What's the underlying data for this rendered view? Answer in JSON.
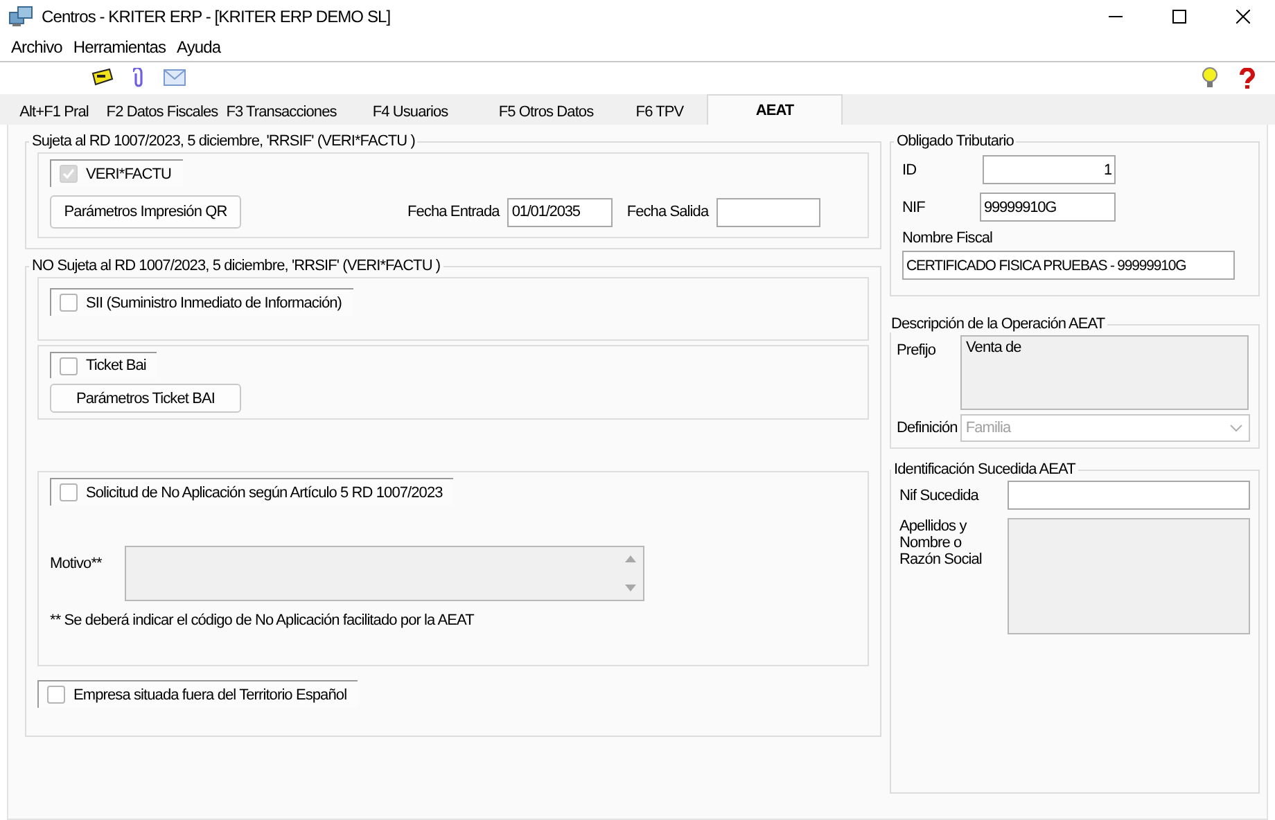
{
  "window": {
    "title": "Centros - KRITER ERP -  [KRITER ERP DEMO SL]"
  },
  "menu": [
    "Archivo",
    "Herramientas",
    "Ayuda"
  ],
  "tabs": [
    {
      "label": "Alt+F1 Pral",
      "selected": false
    },
    {
      "label": "F2 Datos Fiscales",
      "selected": false
    },
    {
      "label": "F3 Transacciones",
      "selected": false
    },
    {
      "label": "F4 Usuarios",
      "selected": false
    },
    {
      "label": "F5 Otros Datos",
      "selected": false
    },
    {
      "label": "F6 TPV",
      "selected": false
    },
    {
      "label": "AEAT",
      "selected": true
    }
  ],
  "sujeta": {
    "title": "Sujeta al RD 1007/2023, 5 diciembre, 'RRSIF'  (VERI*FACTU )",
    "verifactu": {
      "label": "VERI*FACTU",
      "checked": true,
      "disabled": true
    },
    "qr_button": "Parámetros Impresión QR",
    "fecha_entrada": {
      "label": "Fecha Entrada",
      "value": "01/01/2035"
    },
    "fecha_salida": {
      "label": "Fecha Salida"
    }
  },
  "no_sujeta": {
    "title": "NO Sujeta al RD 1007/2023, 5 diciembre, 'RRSIF'  (VERI*FACTU )",
    "sii": {
      "label": "SII (Suministro Inmediato de Información)",
      "checked": false,
      "disabled": false
    },
    "ticket_bai": {
      "label": "Ticket Bai",
      "checked": false,
      "disabled": false
    },
    "ticket_bai_button": "Parámetros Ticket BAI",
    "no_aplicacion": {
      "label": "Solicitud de No Aplicación según Artículo 5 RD 1007/2023",
      "checked": false,
      "disabled": false
    },
    "motivo": {
      "label": "Motivo**"
    },
    "note": "** Se deberá indicar el código de No Aplicación facilitado por la AEAT",
    "fuera_territorio": {
      "label": "Empresa situada fuera del Territorio Español",
      "checked": false,
      "disabled": false
    }
  },
  "obligado": {
    "title": "Obligado Tributario",
    "id": {
      "label": "ID",
      "value": "1"
    },
    "nif": {
      "label": "NIF",
      "value": "99999910G"
    },
    "nombre_fiscal": {
      "label": "Nombre Fiscal",
      "value": "CERTIFICADO FISICA PRUEBAS - 99999910G"
    }
  },
  "descripcion": {
    "title": "Descripción de la Operación AEAT",
    "prefijo": {
      "label": "Prefijo",
      "value": "Venta de"
    },
    "definicion": {
      "label": "Definición",
      "value": "Familia"
    }
  },
  "sucedida": {
    "title": "Identificación Sucedida AEAT",
    "nif": {
      "label": "Nif Sucedida"
    },
    "nombre": {
      "label": "Apellidos y Nombre o Razón Social"
    }
  }
}
